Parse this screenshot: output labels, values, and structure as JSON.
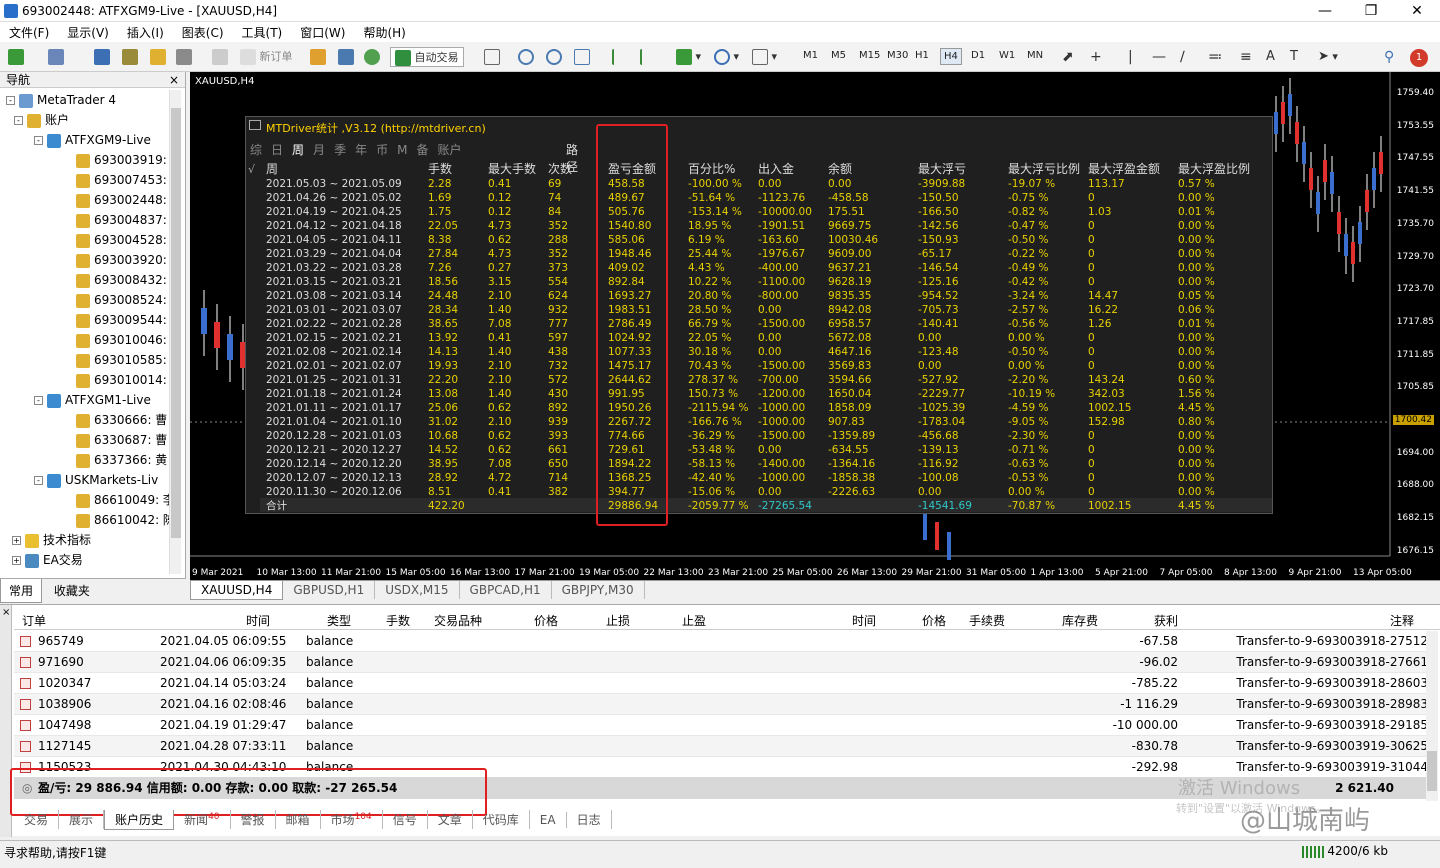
{
  "window": {
    "title": "693002448: ATFXGM9-Live - [XAUUSD,H4]"
  },
  "menu": [
    "文件(F)",
    "显示(V)",
    "插入(I)",
    "图表(C)",
    "工具(T)",
    "窗口(W)",
    "帮助(H)"
  ],
  "toolbar": {
    "new_order": "新订单",
    "auto_trade": "自动交易",
    "timeframes": [
      "M1",
      "M5",
      "M15",
      "M30",
      "H1",
      "H4",
      "D1",
      "W1",
      "MN"
    ],
    "active_timeframe": "H4",
    "alert_count": "1"
  },
  "navigator": {
    "title": "导航",
    "root": "MetaTrader 4",
    "accounts_label": "账户",
    "servers": [
      {
        "name": "ATFXGM9-Live",
        "accounts": [
          "693003919:",
          "693007453:",
          "693002448:",
          "693004837:",
          "693004528:",
          "693003920:",
          "693008432:",
          "693008524:",
          "693009544:",
          "693010046:",
          "693010585:",
          "693010014:"
        ]
      },
      {
        "name": "ATFXGM1-Live",
        "accounts": [
          "6330666: 曹",
          "6330687: 曹",
          "6337366: 黄"
        ]
      },
      {
        "name": "USKMarkets-Liv",
        "accounts": [
          "86610049: 李",
          "86610042: 陈"
        ]
      }
    ],
    "indicators_label": "技术指标",
    "ea_label": "EA交易",
    "tabs": [
      "常用",
      "收藏夹"
    ]
  },
  "chart": {
    "symbol_label": "XAUUSD,H4",
    "price_ticks": [
      "1759.40",
      "1753.55",
      "1747.55",
      "1741.55",
      "1735.70",
      "1729.70",
      "1723.70",
      "1717.85",
      "1711.85",
      "1705.85",
      "1700.42",
      "1694.00",
      "1688.00",
      "1682.15",
      "1676.15"
    ],
    "current_price": "1700.42",
    "time_ticks": [
      "9 Mar 2021",
      "10 Mar 13:00",
      "11 Mar 21:00",
      "15 Mar 05:00",
      "16 Mar 13:00",
      "17 Mar 21:00",
      "19 Mar 05:00",
      "22 Mar 13:00",
      "23 Mar 21:00",
      "25 Mar 05:00",
      "26 Mar 13:00",
      "29 Mar 21:00",
      "31 Mar 05:00",
      "1 Apr 13:00",
      "5 Apr 21:00",
      "7 Apr 05:00",
      "8 Apr 13:00",
      "9 Apr 21:00",
      "13 Apr 05:00"
    ]
  },
  "stats_panel": {
    "title": "MTDriver统计 ,V3.12 (http://mtdriver.cn)",
    "filters": [
      "综",
      "日",
      "周",
      "月",
      "季",
      "年",
      "币",
      "M",
      "备",
      "账户"
    ],
    "path_label": "路径",
    "headers": [
      "周",
      "手数",
      "最大手数",
      "次数",
      "盈亏金额",
      "百分比%",
      "出入金",
      "余额",
      "最大浮亏",
      "最大浮亏比例",
      "最大浮盈金额",
      "最大浮盈比例"
    ],
    "rows": [
      [
        "2021.05.03 ~ 2021.05.09",
        "2.28",
        "0.41",
        "69",
        "458.58",
        "-100.00 %",
        "0.00",
        "0.00",
        "-3909.88",
        "-19.07 %",
        "113.17",
        "0.57 %"
      ],
      [
        "2021.04.26 ~ 2021.05.02",
        "1.69",
        "0.12",
        "74",
        "489.67",
        "-51.64 %",
        "-1123.76",
        "-458.58",
        "-150.50",
        "-0.75 %",
        "0",
        "0.00 %"
      ],
      [
        "2021.04.19 ~ 2021.04.25",
        "1.75",
        "0.12",
        "84",
        "505.76",
        "-153.14 %",
        "-10000.00",
        "175.51",
        "-166.50",
        "-0.82 %",
        "1.03",
        "0.01 %"
      ],
      [
        "2021.04.12 ~ 2021.04.18",
        "22.05",
        "4.73",
        "352",
        "1540.80",
        "18.95 %",
        "-1901.51",
        "9669.75",
        "-142.56",
        "-0.47 %",
        "0",
        "0.00 %"
      ],
      [
        "2021.04.05 ~ 2021.04.11",
        "8.38",
        "0.62",
        "288",
        "585.06",
        "6.19 %",
        "-163.60",
        "10030.46",
        "-150.93",
        "-0.50 %",
        "0",
        "0.00 %"
      ],
      [
        "2021.03.29 ~ 2021.04.04",
        "27.84",
        "4.73",
        "352",
        "1948.46",
        "25.44 %",
        "-1976.67",
        "9609.00",
        "-65.17",
        "-0.22 %",
        "0",
        "0.00 %"
      ],
      [
        "2021.03.22 ~ 2021.03.28",
        "7.26",
        "0.27",
        "373",
        "409.02",
        "4.43 %",
        "-400.00",
        "9637.21",
        "-146.54",
        "-0.49 %",
        "0",
        "0.00 %"
      ],
      [
        "2021.03.15 ~ 2021.03.21",
        "18.56",
        "3.15",
        "554",
        "892.84",
        "10.22 %",
        "-1100.00",
        "9628.19",
        "-125.16",
        "-0.42 %",
        "0",
        "0.00 %"
      ],
      [
        "2021.03.08 ~ 2021.03.14",
        "24.48",
        "2.10",
        "624",
        "1693.27",
        "20.80 %",
        "-800.00",
        "9835.35",
        "-954.52",
        "-3.24 %",
        "14.47",
        "0.05 %"
      ],
      [
        "2021.03.01 ~ 2021.03.07",
        "28.34",
        "1.40",
        "932",
        "1983.51",
        "28.50 %",
        "0.00",
        "8942.08",
        "-705.73",
        "-2.57 %",
        "16.22",
        "0.06 %"
      ],
      [
        "2021.02.22 ~ 2021.02.28",
        "38.65",
        "7.08",
        "777",
        "2786.49",
        "66.79 %",
        "-1500.00",
        "6958.57",
        "-140.41",
        "-0.56 %",
        "1.26",
        "0.01 %"
      ],
      [
        "2021.02.15 ~ 2021.02.21",
        "13.92",
        "0.41",
        "597",
        "1024.92",
        "22.05 %",
        "0.00",
        "5672.08",
        "0.00",
        "0.00 %",
        "0",
        "0.00 %"
      ],
      [
        "2021.02.08 ~ 2021.02.14",
        "14.13",
        "1.40",
        "438",
        "1077.33",
        "30.18 %",
        "0.00",
        "4647.16",
        "-123.48",
        "-0.50 %",
        "0",
        "0.00 %"
      ],
      [
        "2021.02.01 ~ 2021.02.07",
        "19.93",
        "2.10",
        "732",
        "1475.17",
        "70.43 %",
        "-1500.00",
        "3569.83",
        "0.00",
        "0.00 %",
        "0",
        "0.00 %"
      ],
      [
        "2021.01.25 ~ 2021.01.31",
        "22.20",
        "2.10",
        "572",
        "2644.62",
        "278.37 %",
        "-700.00",
        "3594.66",
        "-527.92",
        "-2.20 %",
        "143.24",
        "0.60 %"
      ],
      [
        "2021.01.18 ~ 2021.01.24",
        "13.08",
        "1.40",
        "430",
        "991.95",
        "150.73 %",
        "-1200.00",
        "1650.04",
        "-2229.77",
        "-10.19 %",
        "342.03",
        "1.56 %"
      ],
      [
        "2021.01.11 ~ 2021.01.17",
        "25.06",
        "0.62",
        "892",
        "1950.26",
        "-2115.94 %",
        "-1000.00",
        "1858.09",
        "-1025.39",
        "-4.59 %",
        "1002.15",
        "4.45 %"
      ],
      [
        "2021.01.04 ~ 2021.01.10",
        "31.02",
        "2.10",
        "939",
        "2267.72",
        "-166.76 %",
        "-1000.00",
        "907.83",
        "-1783.04",
        "-9.05 %",
        "152.98",
        "0.80 %"
      ],
      [
        "2020.12.28 ~ 2021.01.03",
        "10.68",
        "0.62",
        "393",
        "774.66",
        "-36.29 %",
        "-1500.00",
        "-1359.89",
        "-456.68",
        "-2.30 %",
        "0",
        "0.00 %"
      ],
      [
        "2020.12.21 ~ 2020.12.27",
        "14.52",
        "0.62",
        "661",
        "729.61",
        "-53.48 %",
        "0.00",
        "-634.55",
        "-139.13",
        "-0.71 %",
        "0",
        "0.00 %"
      ],
      [
        "2020.12.14 ~ 2020.12.20",
        "38.95",
        "7.08",
        "650",
        "1894.22",
        "-58.13 %",
        "-1400.00",
        "-1364.16",
        "-116.92",
        "-0.63 %",
        "0",
        "0.00 %"
      ],
      [
        "2020.12.07 ~ 2020.12.13",
        "28.92",
        "4.72",
        "714",
        "1368.25",
        "-42.40 %",
        "-1000.00",
        "-1858.38",
        "-100.08",
        "-0.53 %",
        "0",
        "0.00 %"
      ],
      [
        "2020.11.30 ~ 2020.12.06",
        "8.51",
        "0.41",
        "382",
        "394.77",
        "-15.06 %",
        "0.00",
        "-2226.63",
        "0.00",
        "0.00 %",
        "0",
        "0.00 %"
      ]
    ],
    "total": [
      "合计",
      "422.20",
      "",
      "",
      "29886.94",
      "-2059.77 %",
      "-27265.54",
      "",
      "-14541.69",
      "-70.87 %",
      "1002.15",
      "4.45 %"
    ]
  },
  "chart_tabs": [
    "XAUUSD,H4",
    "GBPUSD,H1",
    "USDX,M15",
    "GBPCAD,H1",
    "GBPJPY,M30"
  ],
  "terminal": {
    "headers": [
      "订单",
      "时间",
      "类型",
      "手数",
      "交易品种",
      "价格",
      "止损",
      "止盈",
      "时间",
      "价格",
      "手续费",
      "库存费",
      "获利",
      "注释"
    ],
    "rows": [
      [
        "965749",
        "2021.04.05 06:09:55",
        "balance",
        "-67.58",
        "Transfer-to-9-693003918-27512"
      ],
      [
        "971690",
        "2021.04.06 06:09:35",
        "balance",
        "-96.02",
        "Transfer-to-9-693003918-27661"
      ],
      [
        "1020347",
        "2021.04.14 05:03:24",
        "balance",
        "-785.22",
        "Transfer-to-9-693003918-28603"
      ],
      [
        "1038906",
        "2021.04.16 02:08:46",
        "balance",
        "-1 116.29",
        "Transfer-to-9-693003918-28983"
      ],
      [
        "1047498",
        "2021.04.19 01:29:47",
        "balance",
        "-10 000.00",
        "Transfer-to-9-693003918-29185"
      ],
      [
        "1127145",
        "2021.04.28 07:33:11",
        "balance",
        "-830.78",
        "Transfer-to-9-693003919-30625"
      ],
      [
        "1150523",
        "2021.04.30 04:43:10",
        "balance",
        "-292.98",
        "Transfer-to-9-693003919-31044"
      ]
    ],
    "summary": "盈/亏: 29 886.94  信用额: 0.00  存款: 0.00  取款: -27 265.54",
    "summary_total": "2 621.40",
    "tabs": [
      {
        "label": "交易",
        "badge": ""
      },
      {
        "label": "展示",
        "badge": ""
      },
      {
        "label": "账户历史",
        "badge": ""
      },
      {
        "label": "新闻",
        "badge": "40"
      },
      {
        "label": "警报",
        "badge": ""
      },
      {
        "label": "邮箱",
        "badge": ""
      },
      {
        "label": "市场",
        "badge": "104"
      },
      {
        "label": "信号",
        "badge": ""
      },
      {
        "label": "文章",
        "badge": ""
      },
      {
        "label": "代码库",
        "badge": ""
      },
      {
        "label": "EA",
        "badge": ""
      },
      {
        "label": "日志",
        "badge": ""
      }
    ],
    "active_tab": "账户历史"
  },
  "status": {
    "help": "寻求帮助,请按F1键",
    "traffic": "4200/6 kb"
  },
  "watermark": {
    "activate": "激活 Windows",
    "activate_sub": "转到\"设置\"以激活 Windows。",
    "brand": "@山城南屿"
  }
}
